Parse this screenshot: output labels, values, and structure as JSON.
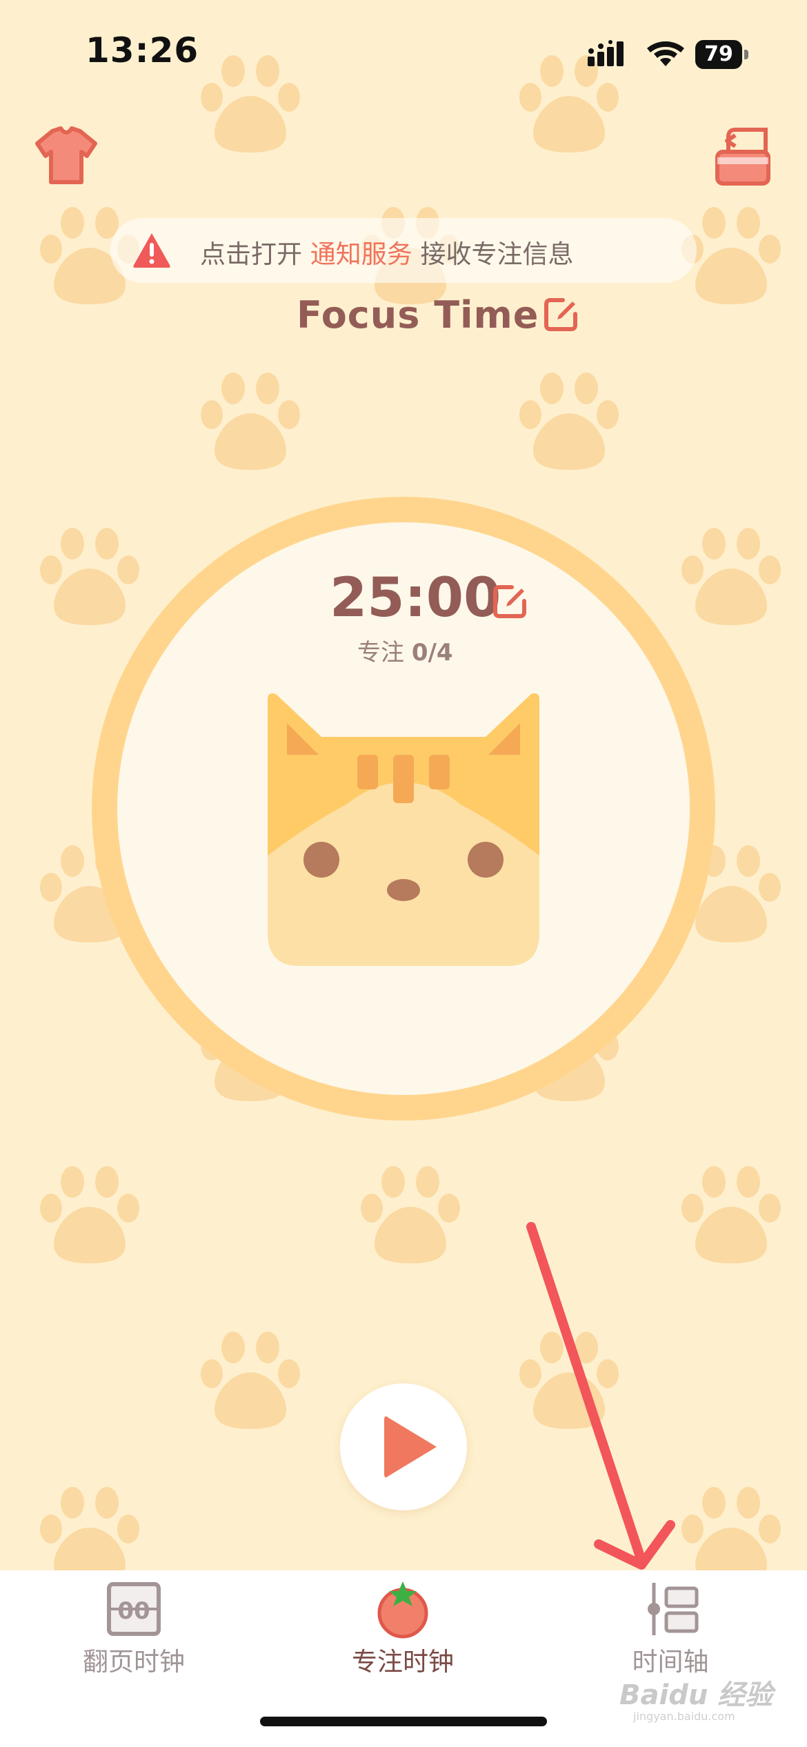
{
  "status_bar": {
    "time": "13:26",
    "battery_level": "79",
    "icons": [
      "signal-icon",
      "wifi-icon",
      "battery-icon"
    ]
  },
  "top_bar": {
    "left_icon": "tshirt-icon",
    "right_icon": "rotate-lock-icon"
  },
  "notice_banner": {
    "icon": "warning-icon",
    "text_before": "点击打开",
    "link_text": "通知服务",
    "text_after": "接收专注信息"
  },
  "task": {
    "title": "Focus Time",
    "edit_icon": "edit-icon"
  },
  "timer": {
    "time": "25:00",
    "focus_label": "专注",
    "focus_progress": "0/4"
  },
  "controls": {
    "play_icon": "play-icon"
  },
  "tab_bar": {
    "tabs": [
      {
        "label": "翻页时钟",
        "icon": "flip-clock-icon",
        "active": false
      },
      {
        "label": "专注时钟",
        "icon": "tomato-icon",
        "active": true
      },
      {
        "label": "时间轴",
        "icon": "timeline-icon",
        "active": false
      }
    ]
  },
  "watermark": {
    "text": "Baidu 经验",
    "sub": "jingyan.baidu.com"
  },
  "colors": {
    "background": "#FEF0CE",
    "paw": "#FBD9A3",
    "ring": "#FFD58E",
    "accent": "#F0735C",
    "title": "#935C56",
    "arrow": "#F2555A"
  }
}
